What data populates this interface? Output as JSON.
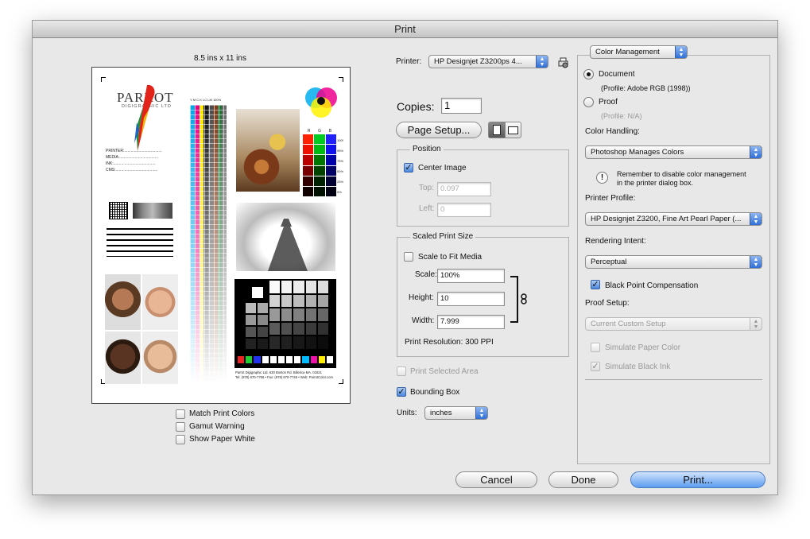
{
  "window": {
    "title": "Print"
  },
  "preview": {
    "paper_size": "8.5 ins x 11 ins",
    "logo_title": "PARROT",
    "logo_subtitle": "DIGIGRAPHIC LTD",
    "fields": [
      "PRINTER:..................................",
      "MEDIA:...................................",
      "INK:......................................",
      "CMS:......................................"
    ],
    "column_labels": [
      "Y",
      "M",
      "C",
      "K",
      "LC",
      "LM",
      "100%"
    ],
    "rgb_labels": [
      "R",
      "G",
      "B"
    ],
    "rgb_percents": [
      "100%",
      "95%",
      "75%",
      "50%",
      "25%",
      "5%"
    ],
    "footer_line1": "Parrot Digigraphic Ltd. 630 Boston Rd. Billerica MA. 01821",
    "footer_line2": "Tel: (978) 670-7766 • Fax: (978) 670-7746 • Web: ParrotColor.com"
  },
  "preview_options": {
    "match_print_colors": {
      "label": "Match Print Colors",
      "checked": false
    },
    "gamut_warning": {
      "label": "Gamut Warning",
      "checked": false
    },
    "show_paper_white": {
      "label": "Show Paper White",
      "checked": false
    }
  },
  "printer": {
    "label": "Printer:",
    "value": "HP Designjet Z3200ps 4..."
  },
  "copies": {
    "label": "Copies:",
    "value": "1"
  },
  "page_setup": {
    "label": "Page Setup..."
  },
  "position": {
    "title": "Position",
    "center_image": {
      "label": "Center Image",
      "checked": true
    },
    "top_label": "Top:",
    "top_value": "0.097",
    "left_label": "Left:",
    "left_value": "0"
  },
  "scaled_print_size": {
    "title": "Scaled Print Size",
    "scale_to_fit": {
      "label": "Scale to Fit Media",
      "checked": false
    },
    "scale_label": "Scale:",
    "scale_value": "100%",
    "height_label": "Height:",
    "height_value": "10",
    "width_label": "Width:",
    "width_value": "7.999",
    "resolution": "Print Resolution: 300 PPI"
  },
  "print_selected_area": {
    "label": "Print Selected Area",
    "checked": false
  },
  "bounding_box": {
    "label": "Bounding Box",
    "checked": true
  },
  "units": {
    "label": "Units:",
    "value": "inches"
  },
  "color_management": {
    "section": "Color Management",
    "document": {
      "label": "Document",
      "profile": "(Profile: Adobe RGB (1998))",
      "selected": true
    },
    "proof": {
      "label": "Proof",
      "profile": "(Profile: N/A)",
      "selected": false
    },
    "color_handling_label": "Color Handling:",
    "color_handling_value": "Photoshop Manages Colors",
    "warning_line1": "Remember to disable color management",
    "warning_line2": "in the printer dialog box.",
    "printer_profile_label": "Printer Profile:",
    "printer_profile_value": "HP Designjet Z3200, Fine Art Pearl Paper (...",
    "rendering_intent_label": "Rendering Intent:",
    "rendering_intent_value": "Perceptual",
    "black_point": {
      "label": "Black Point Compensation",
      "checked": true
    },
    "proof_setup_label": "Proof Setup:",
    "proof_setup_value": "Current Custom Setup",
    "simulate_paper": {
      "label": "Simulate Paper Color",
      "checked": false
    },
    "simulate_black": {
      "label": "Simulate Black Ink",
      "checked": true
    }
  },
  "buttons": {
    "cancel": "Cancel",
    "done": "Done",
    "print": "Print..."
  },
  "colors": {
    "accent": "#4a86dc",
    "window_bg": "#e8e8e8"
  }
}
